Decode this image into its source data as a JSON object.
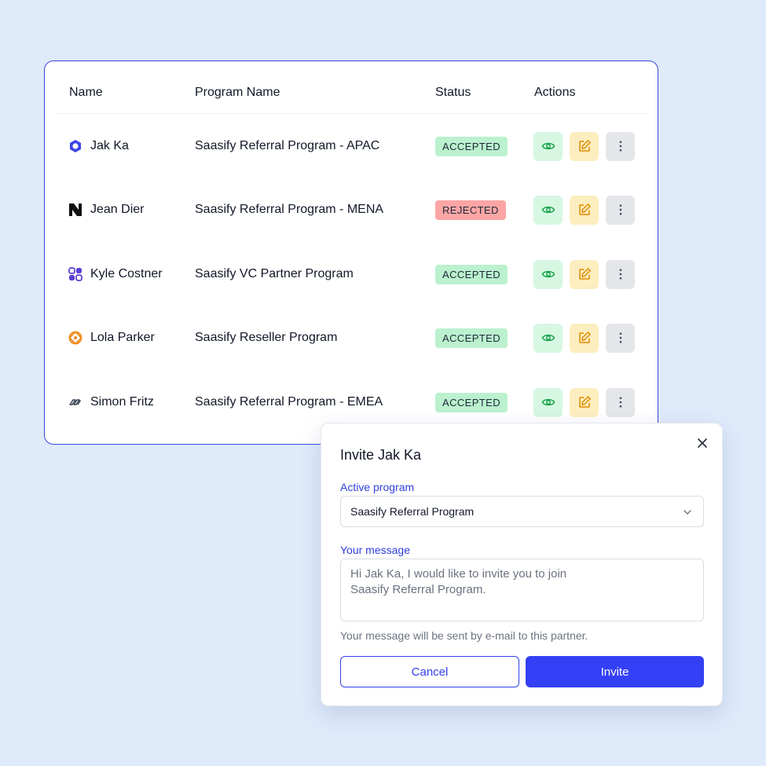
{
  "table": {
    "headers": {
      "name": "Name",
      "program": "Program Name",
      "status": "Status",
      "actions": "Actions"
    },
    "rows": [
      {
        "name": "Jak Ka",
        "logo": "blue-ring-logo",
        "program": "Saasify Referral Program - APAC",
        "status": "ACCEPTED"
      },
      {
        "name": "Jean Dier",
        "logo": "black-n-logo",
        "program": "Saasify Referral Program - MENA",
        "status": "REJECTED"
      },
      {
        "name": "Kyle Costner",
        "logo": "purple-blocks-logo",
        "program": "Saasify VC Partner Program",
        "status": "ACCEPTED"
      },
      {
        "name": "Lola Parker",
        "logo": "orange-flower-logo",
        "program": "Saasify Reseller Program",
        "status": "ACCEPTED"
      },
      {
        "name": "Simon Fritz",
        "logo": "chain-link-logo",
        "program": "Saasify Referral Program - EMEA",
        "status": "ACCEPTED"
      }
    ],
    "action_icons": [
      "eye-icon",
      "edit-icon",
      "more-vertical-icon"
    ]
  },
  "modal": {
    "title": "Invite Jak Ka",
    "program_label": "Active program",
    "program_value": "Saasify Referral Program",
    "message_label": "Your message",
    "message_placeholder": "Hi Jak Ka, I would like to invite you to join Saasify Referral Program.",
    "help_text": "Your message will be sent by e-mail to this partner.",
    "cancel_label": "Cancel",
    "invite_label": "Invite"
  },
  "colors": {
    "background": "#dfebfb",
    "accent": "#3340f5",
    "accepted": "#bbf1cf",
    "rejected": "#fca5a5",
    "view_bg": "#d7f7e3",
    "edit_bg": "#fdeec0",
    "more_bg": "#e4e6ea"
  }
}
